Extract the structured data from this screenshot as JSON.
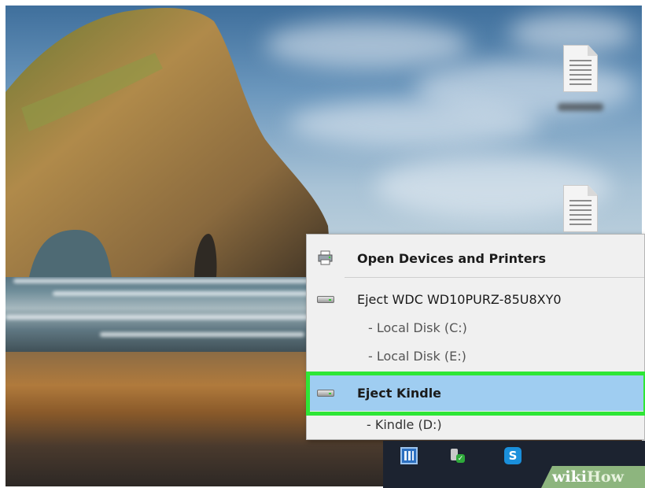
{
  "menu": {
    "items": [
      {
        "label": "Open Devices and Printers",
        "icon": "printer-icon",
        "bold": true
      },
      {
        "label": "Eject WDC WD10PURZ-85U8XY0",
        "icon": "drive-icon"
      },
      {
        "label": "- Local Disk (C:)"
      },
      {
        "label": "- Local Disk (E:)"
      },
      {
        "label": "Eject Kindle",
        "icon": "drive-icon",
        "bold": true,
        "highlighted": true
      },
      {
        "label": "- Kindle (D:)"
      }
    ],
    "highlight_color": "#9fcdf1",
    "callout_color": "#2ee636"
  },
  "taskbar": {
    "tray_icons": [
      "network-icon",
      "usb-safe-remove-icon",
      "skype-icon"
    ],
    "skype_letter": "S"
  },
  "watermark": {
    "part1": "wiki",
    "part2": "How"
  }
}
